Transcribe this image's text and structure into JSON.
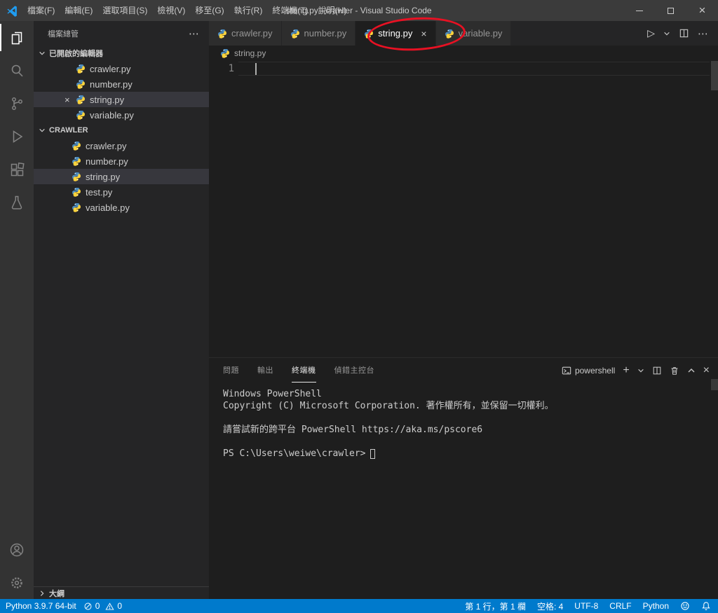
{
  "title_bar": {
    "menus": [
      {
        "label": "檔案(F)"
      },
      {
        "label": "編輯(E)"
      },
      {
        "label": "選取項目(S)"
      },
      {
        "label": "檢視(V)"
      },
      {
        "label": "移至(G)"
      },
      {
        "label": "執行(R)"
      },
      {
        "label": "終端機(T)"
      },
      {
        "label": "說明(H)"
      }
    ],
    "title": "string.py - crawler - Visual Studio Code"
  },
  "sidebar": {
    "title": "檔案總管",
    "open_editors": {
      "label": "已開啟的編輯器",
      "items": [
        {
          "name": "crawler.py"
        },
        {
          "name": "number.py"
        },
        {
          "name": "string.py"
        },
        {
          "name": "variable.py"
        }
      ]
    },
    "workspace": {
      "label": "CRAWLER",
      "items": [
        {
          "name": "crawler.py"
        },
        {
          "name": "number.py"
        },
        {
          "name": "string.py"
        },
        {
          "name": "test.py"
        },
        {
          "name": "variable.py"
        }
      ]
    },
    "outline": {
      "label": "大綱"
    }
  },
  "editor": {
    "tabs": [
      {
        "label": "crawler.py"
      },
      {
        "label": "number.py"
      },
      {
        "label": "string.py"
      },
      {
        "label": "variable.py"
      }
    ],
    "active_tab": "string.py",
    "breadcrumb": "string.py",
    "line_number": "1"
  },
  "panel": {
    "tabs": [
      {
        "label": "問題"
      },
      {
        "label": "輸出"
      },
      {
        "label": "終端機"
      },
      {
        "label": "偵錯主控台"
      }
    ],
    "active_tab": "終端機",
    "shell": "powershell",
    "terminal": {
      "lines": [
        "Windows PowerShell",
        "Copyright (C) Microsoft Corporation. 著作權所有，並保留一切權利。",
        "",
        "請嘗試新的跨平台 PowerShell https://aka.ms/pscore6",
        "",
        "PS C:\\Users\\weiwe\\crawler>"
      ]
    }
  },
  "status_bar": {
    "python_version": "Python 3.9.7 64-bit",
    "errors": "0",
    "warnings": "0",
    "cursor_position": "第 1 行，第 1 欄",
    "indentation": "空格: 4",
    "encoding": "UTF-8",
    "eol": "CRLF",
    "language": "Python"
  },
  "icons": {
    "more": "⋯",
    "play": "▷",
    "plus": "+",
    "close": "×"
  },
  "colors": {
    "status_bar": "#007acc",
    "annotation": "#e81123",
    "python_blue": "#4B8BBE",
    "python_yellow": "#FFD43B"
  }
}
